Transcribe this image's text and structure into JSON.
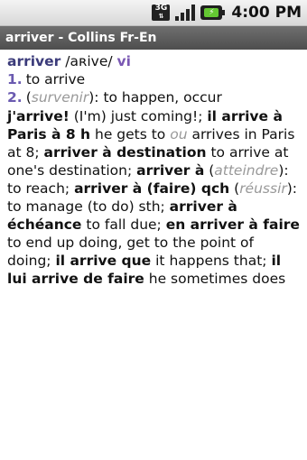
{
  "status": {
    "network": "3G",
    "time": "4:00 PM"
  },
  "title": "arriver - Collins Fr-En",
  "entry": {
    "headword": "arriver",
    "pronunciation": "/aʀive/",
    "pos": "vi",
    "senses": [
      {
        "num": "1.",
        "text": "to arrive"
      },
      {
        "num": "2.",
        "paren_open": "(",
        "label": "survenir",
        "paren_close": "):",
        "text": " to happen, occur"
      }
    ],
    "examples": {
      "p1": "j'arrive!",
      "t1": " (I'm) just coming!; ",
      "p2": "il arrive à Paris à 8 h",
      "t2a": " he gets to ",
      "ou": "ou",
      "t2b": " arrives in Paris at 8; ",
      "p3": "arriver à destination",
      "t3": " to arrive at one's destination; ",
      "p4": "arriver à",
      "t4a": " (",
      "l4": "atteindre",
      "t4b": "): to reach; ",
      "p5": "arriver à (faire) qch",
      "t5a": " (",
      "l5": "réussir",
      "t5b": "): to manage (to do) sth; ",
      "p6": "arriver à échéance",
      "t6": " to fall due; ",
      "p7": "en arriver à faire",
      "t7": " to end up doing, get to the point of doing; ",
      "p8": "il arrive que",
      "t8": " it happens that; ",
      "p9": "il lui arrive de faire",
      "t9": " he sometimes does"
    }
  }
}
